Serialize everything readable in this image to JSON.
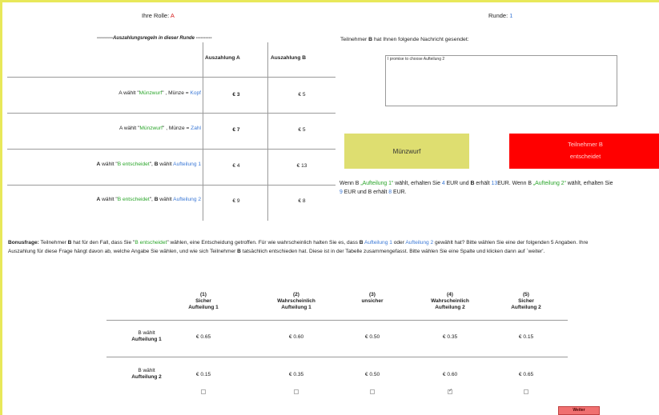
{
  "header": {
    "role_label": "Ihre Rolle:",
    "role_value": "A",
    "round_label": "Runde:",
    "round_value": "1"
  },
  "payout_table": {
    "title": "----------Auszahlungsregeln in dieser Runde ----------",
    "col_a": "Auszahlung A",
    "col_b": "Auszahlung B",
    "rows": [
      {
        "pre": "A wählt \"",
        "choice": "Münzwurf",
        "mid": "\" , Münze = ",
        "outcome": "Kopf",
        "a": "€ 3",
        "b": "€ 5"
      },
      {
        "pre": "A wählt \"",
        "choice": "Münzwurf",
        "mid": "\" , Münze = ",
        "outcome": "Zahl",
        "a": "€ 7",
        "b": "€ 5"
      },
      {
        "actor": "A",
        "pre": " wählt \"",
        "choice": "B entscheidet",
        "mid": "\", ",
        "actor2": "B",
        "mid2": " wählt ",
        "outcome": "Aufteilung 1",
        "a": "€ 4",
        "b": "€ 13"
      },
      {
        "actor": "A",
        "pre": " wählt \"",
        "choice": "B entscheidet",
        "mid": "\", ",
        "actor2": "B",
        "mid2": " wählt ",
        "outcome": "Aufteilung 2",
        "a": "€ 9",
        "b": "€ 8"
      }
    ]
  },
  "message": {
    "intro_pre": "Teilnehmer ",
    "intro_b": "B",
    "intro_post": " hat Ihnen folgende Nachricht gesendet:",
    "text": "I promise to choose Aufteilung 2"
  },
  "buttons": {
    "coin": "Münzwurf",
    "b_decides_line1": "Teilnehmer B",
    "b_decides_line2": "entscheidet",
    "weiter": "Weiter"
  },
  "info": {
    "p1": "Wenn B ",
    "p2": "„Aufteilung 1“",
    "p3": " wählt, erhalten Sie ",
    "p4": "4",
    "p5": " EUR und ",
    "p6": "B",
    "p7": " erhält ",
    "p8": "13",
    "p9": "EUR. Wenn B ",
    "p10": "„Aufteilung 2“",
    "p11": " wählt, erhalten Sie",
    "p12": "9",
    "p13": " EUR und B erhält ",
    "p14": "8",
    "p15": " EUR."
  },
  "bonus": {
    "label": "Bonusfrage:",
    "t1": " Teilnehmer ",
    "t2": "B",
    "t3": " hat für den Fall, dass Sie \"",
    "t4": "B entscheidet",
    "t5": "\" wählen, eine Entscheidung getroffen. Für wie wahrscheinlich halten Sie es, dass ",
    "t6": "B",
    "t7": " ",
    "t8": "Aufteilung 1",
    "t9": " oder ",
    "t10": "Aufteilung 2",
    "t11": " gewählt hat? Bitte wählen Sie eine der folgenden 5 Angaben. Ihre",
    "line2a": "Auszahlung für diese Frage hängt davon ab, welche Angabe Sie wählen, und wie sich Teilnehmer ",
    "line2b": "B",
    "line2c": " tatsächlich entschieden hat. Diese ist in der Tabelle zusammengefasst. Bitte wählen Sie eine Spalte und klicken dann auf `weiter'."
  },
  "belief_table": {
    "columns": [
      {
        "num": "(1)",
        "l1": "Sicher",
        "l2": "Aufteilung 1"
      },
      {
        "num": "(2)",
        "l1": "Wahrscheinlich",
        "l2": "Aufteilung 1"
      },
      {
        "num": "(3)",
        "l1": "unsicher",
        "l2": ""
      },
      {
        "num": "(4)",
        "l1": "Wahrscheinlich",
        "l2": "Aufteilung 2"
      },
      {
        "num": "(5)",
        "l1": "Sicher",
        "l2": "Aufteilung 2"
      }
    ],
    "rows": [
      {
        "l1": "B wählt",
        "l2": "Aufteilung 1",
        "values": [
          "€ 0.65",
          "€ 0.60",
          "€ 0.50",
          "€ 0.35",
          "€ 0.15"
        ]
      },
      {
        "l1": "B wählt",
        "l2": "Aufteilung 2",
        "values": [
          "€ 0.15",
          "€ 0.35",
          "€ 0.50",
          "€ 0.60",
          "€ 0.65"
        ]
      }
    ],
    "selected_column": 4
  },
  "colors": {
    "green": "#2aa52a",
    "blue": "#3a78d6",
    "red": "#d62020",
    "coin_button": "#dede70",
    "b_button": "#ff0000",
    "weiter_button": "#f07070"
  }
}
